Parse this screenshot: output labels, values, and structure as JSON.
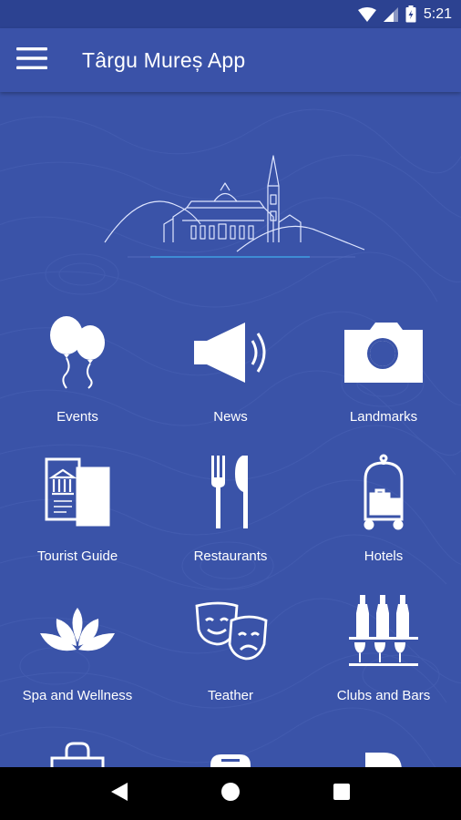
{
  "status_bar": {
    "time": "5:21",
    "icons": [
      "wifi-icon",
      "cellular-signal-icon",
      "battery-icon"
    ]
  },
  "app_bar": {
    "title": "Târgu Mureș App",
    "menu_icon": "hamburger-menu-icon"
  },
  "colors": {
    "background": "#3a52a8",
    "status_bar": "#2c4291",
    "foreground": "#ffffff",
    "nav_bar": "#000000"
  },
  "hero": {
    "image": "city-skyline-illustration"
  },
  "menu": {
    "items": [
      {
        "label": "Events",
        "icon": "balloons-icon"
      },
      {
        "label": "News",
        "icon": "speaker-icon"
      },
      {
        "label": "Landmarks",
        "icon": "camera-icon"
      },
      {
        "label": "Tourist Guide",
        "icon": "guide-booklet-icon"
      },
      {
        "label": "Restaurants",
        "icon": "fork-knife-icon"
      },
      {
        "label": "Hotels",
        "icon": "luggage-cart-icon"
      },
      {
        "label": "Spa and Wellness",
        "icon": "lotus-icon"
      },
      {
        "label": "Teather",
        "icon": "theater-masks-icon"
      },
      {
        "label": "Clubs and Bars",
        "icon": "bottles-glasses-icon"
      },
      {
        "label": "",
        "icon": "shopping-bag-icon"
      },
      {
        "label": "",
        "icon": "transport-icon"
      },
      {
        "label": "",
        "icon": "info-icon"
      }
    ]
  },
  "nav_bar": {
    "buttons": [
      "back-icon",
      "home-icon",
      "recents-icon"
    ]
  }
}
